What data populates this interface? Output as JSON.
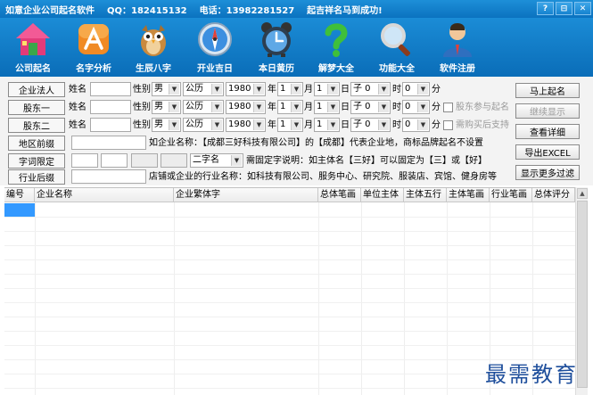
{
  "title": {
    "app": "如意企业公司起名软件",
    "qq": "QQ：182415132",
    "phone": "电话：13982281527",
    "slogan": "起吉祥名马到成功!"
  },
  "window_buttons": [
    "?",
    "⊟",
    "✕"
  ],
  "toolbar": [
    {
      "label": "公司起名",
      "icon": "house-icon"
    },
    {
      "label": "名字分析",
      "icon": "app-store-icon"
    },
    {
      "label": "生辰八字",
      "icon": "owl-icon"
    },
    {
      "label": "开业吉日",
      "icon": "compass-icon"
    },
    {
      "label": "本日黄历",
      "icon": "alarm-clock-icon"
    },
    {
      "label": "解梦大全",
      "icon": "question-mark-icon"
    },
    {
      "label": "功能大全",
      "icon": "magnifier-icon"
    },
    {
      "label": "软件注册",
      "icon": "person-icon"
    }
  ],
  "form": {
    "rows": [
      {
        "label": "企业法人",
        "name_label": "姓名",
        "gender_label": "性别",
        "gender": "男",
        "calendar": "公历",
        "year": "1980",
        "year_unit": "年",
        "month": "1",
        "month_unit": "月",
        "day": "1",
        "day_unit": "日",
        "hour": "子 0",
        "hour_unit": "时",
        "minute": "0",
        "minute_unit": "分"
      },
      {
        "label": "股东一",
        "name_label": "姓名",
        "gender_label": "性别",
        "gender": "男",
        "calendar": "公历",
        "year": "1980",
        "year_unit": "年",
        "month": "1",
        "month_unit": "月",
        "day": "1",
        "day_unit": "日",
        "hour": "子 0",
        "hour_unit": "时",
        "minute": "0",
        "minute_unit": "分",
        "check_label": "股东参与起名"
      },
      {
        "label": "股东二",
        "name_label": "姓名",
        "gender_label": "性别",
        "gender": "男",
        "calendar": "公历",
        "year": "1980",
        "year_unit": "年",
        "month": "1",
        "month_unit": "月",
        "day": "1",
        "day_unit": "日",
        "hour": "子 0",
        "hour_unit": "时",
        "minute": "0",
        "minute_unit": "分",
        "check_label": "需购买后支持"
      }
    ],
    "region": {
      "label": "地区前缀",
      "hint": "如企业名称：【成都三好科技有限公司】的【成都】代表企业地，商标品牌起名不设置"
    },
    "fixed": {
      "label": "字词限定",
      "select": "二字名",
      "hint": "需固定字说明：如主体名【三好】可以固定为【三】或【好】"
    },
    "suffix": {
      "label": "行业后缀",
      "hint": "店铺或企业的行业名称：如科技有限公司、服务中心、研究院、服装店、宾馆、健身房等"
    }
  },
  "buttons": {
    "start": "马上起名",
    "continue": "继续显示",
    "detail": "查看详细",
    "export": "导出EXCEL",
    "filter": "显示更多过滤"
  },
  "grid": {
    "columns": [
      "编号",
      "企业名称",
      "企业繁体字",
      "总体笔画",
      "单位主体",
      "主体五行",
      "主体笔画",
      "行业笔画",
      "总体评分"
    ]
  },
  "watermark": "最需教育",
  "colors": {
    "titlebar": "#0b72bf",
    "selection": "#3399ff",
    "watermark": "#1f4f9c"
  }
}
